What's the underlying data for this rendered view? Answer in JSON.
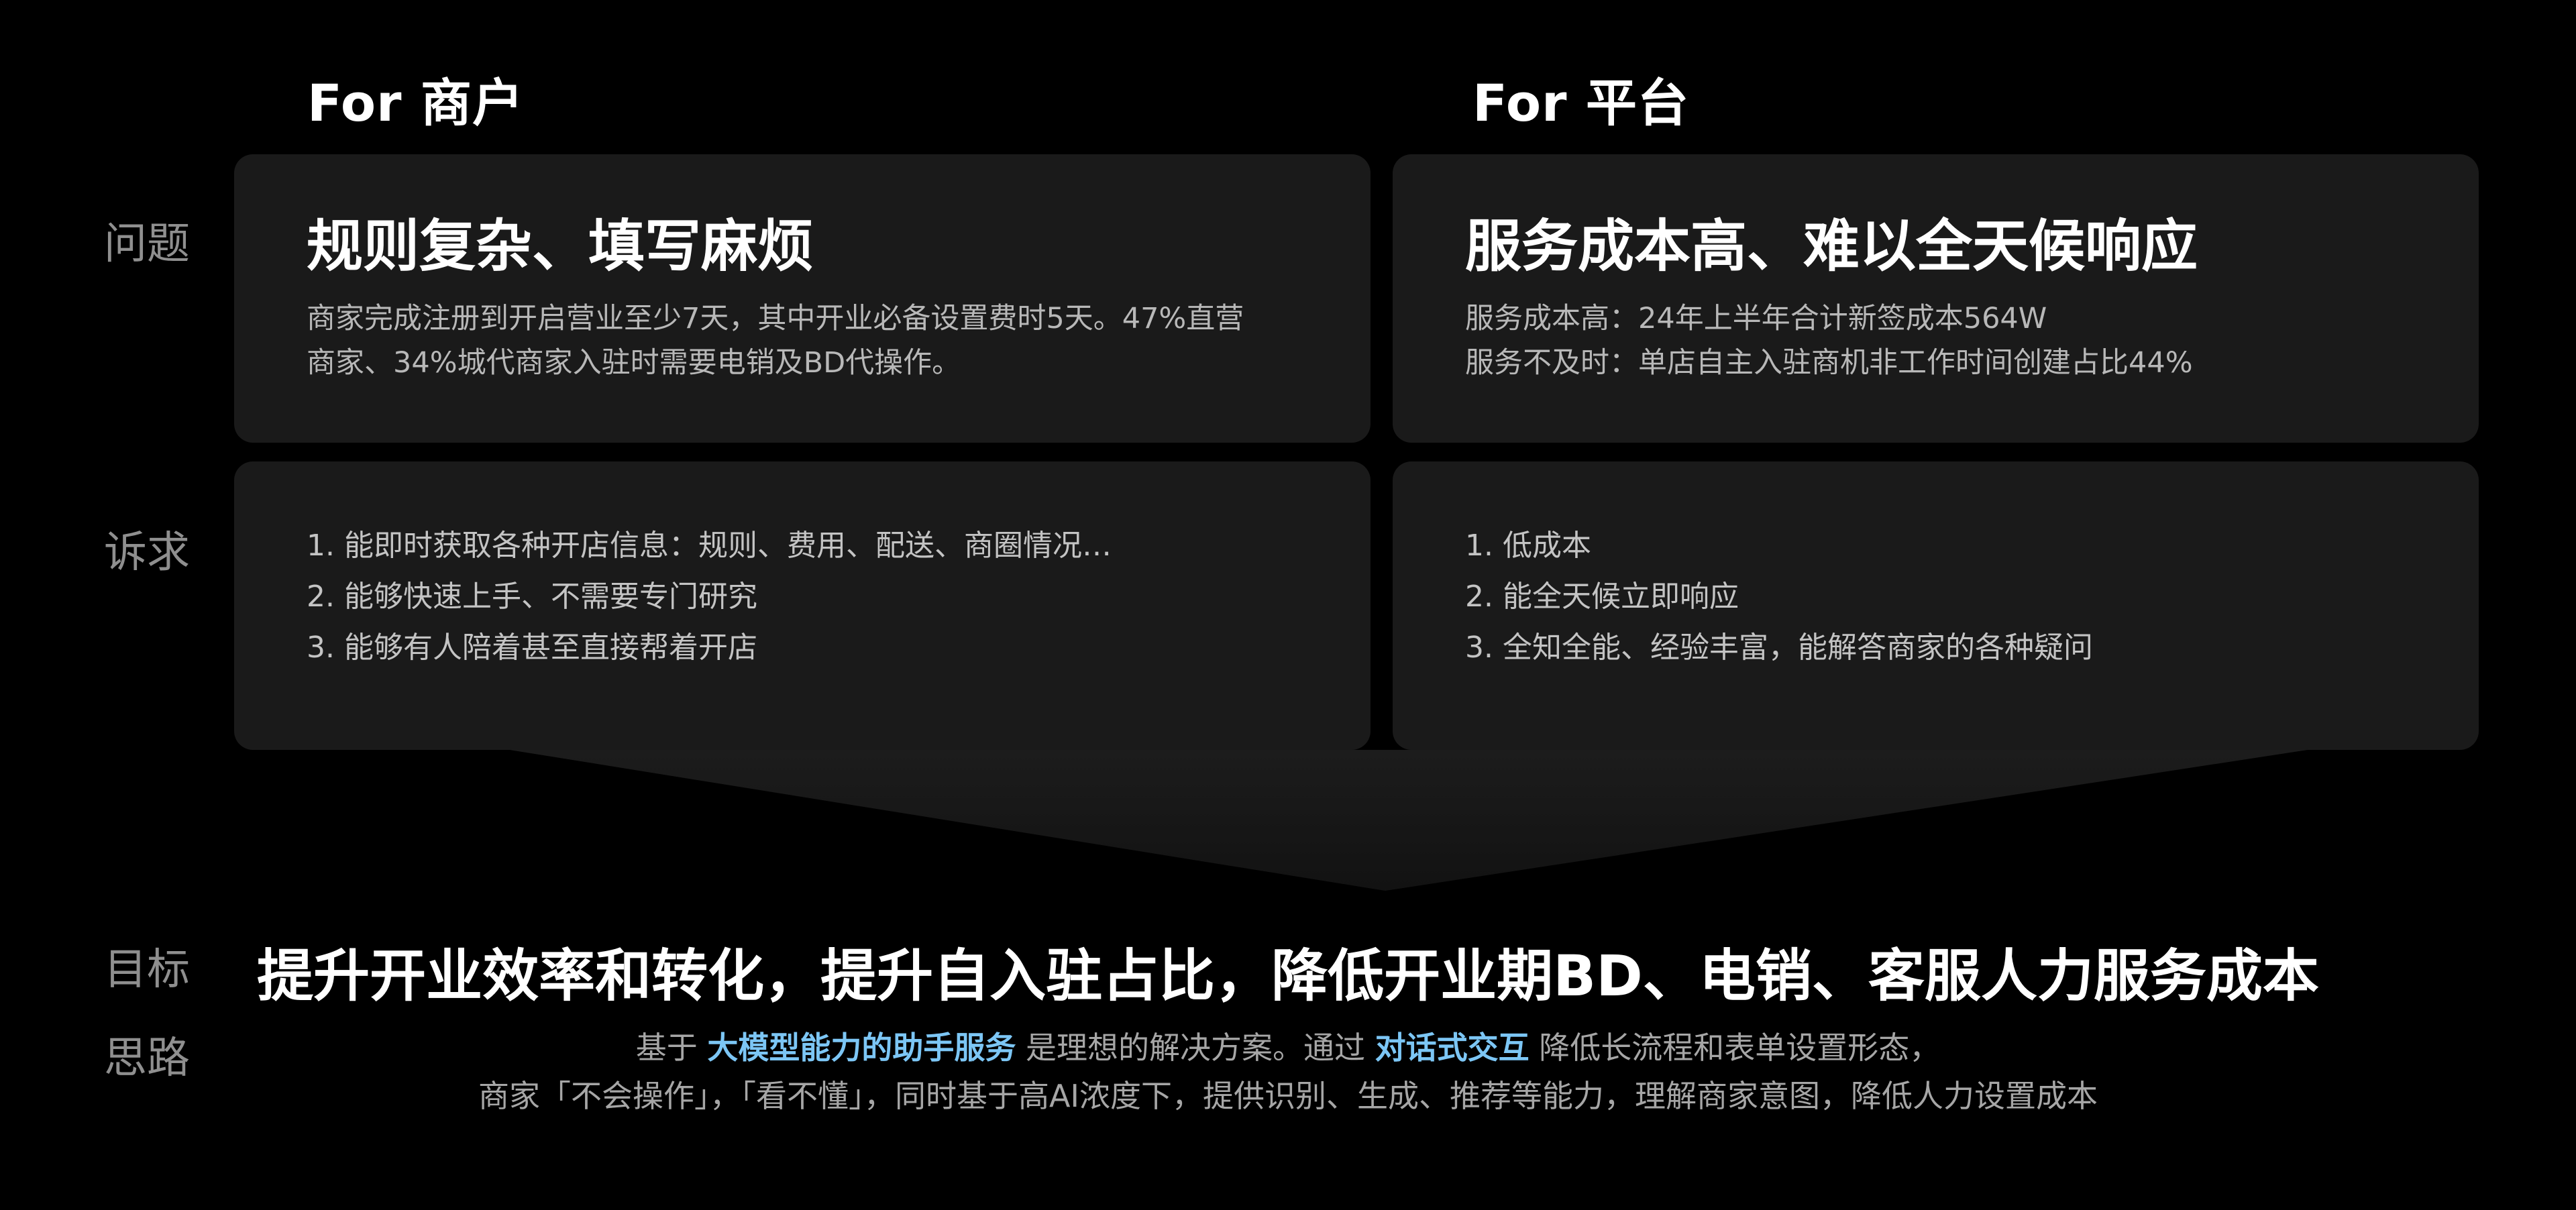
{
  "columns": {
    "merchant": "For 商户",
    "platform": "For 平台"
  },
  "rows": {
    "problem": "问题",
    "appeal": "诉求",
    "goal": "目标",
    "approach": "思路"
  },
  "merchant_problem": {
    "title": "规则复杂、填写麻烦",
    "desc_line1": "商家完成注册到开启营业至少7天，其中开业必备设置费时5天。47%直营",
    "desc_line2": "商家、34%城代商家入驻时需要电销及BD代操作。"
  },
  "platform_problem": {
    "title": "服务成本高、难以全天候响应",
    "desc_line1": "服务成本高：24年上半年合计新签成本564W",
    "desc_line2": "服务不及时：单店自主入驻商机非工作时间创建占比44%"
  },
  "merchant_appeal": {
    "items": [
      "1. 能即时获取各种开店信息：规则、费用、配送、商圈情况…",
      "2. 能够快速上手、不需要专门研究",
      "3. 能够有人陪着甚至直接帮着开店"
    ]
  },
  "platform_appeal": {
    "items": [
      "1. 低成本",
      "2. 能全天候立即响应",
      "3. 全知全能、经验丰富，能解答商家的各种疑问"
    ]
  },
  "goal_text": "提升开业效率和转化，提升自入驻占比，降低开业期BD、电销、客服人力服务成本",
  "approach": {
    "line1_part1": "基于 ",
    "line1_highlight1": "大模型能力的助手服务",
    "line1_part2": " 是理想的解决方案。通过 ",
    "line1_highlight2": "对话式交互",
    "line1_part3": " 降低长流程和表单设置形态，",
    "line2": "商家「不会操作」，「看不懂」，同时基于高AI浓度下，提供识别、生成、推荐等能力，理解商家意图，降低人力设置成本"
  },
  "colors": {
    "background": "#000000",
    "card": "#1a1a1a",
    "highlight": "#7cc6f5",
    "label": "#8f8f8f"
  }
}
